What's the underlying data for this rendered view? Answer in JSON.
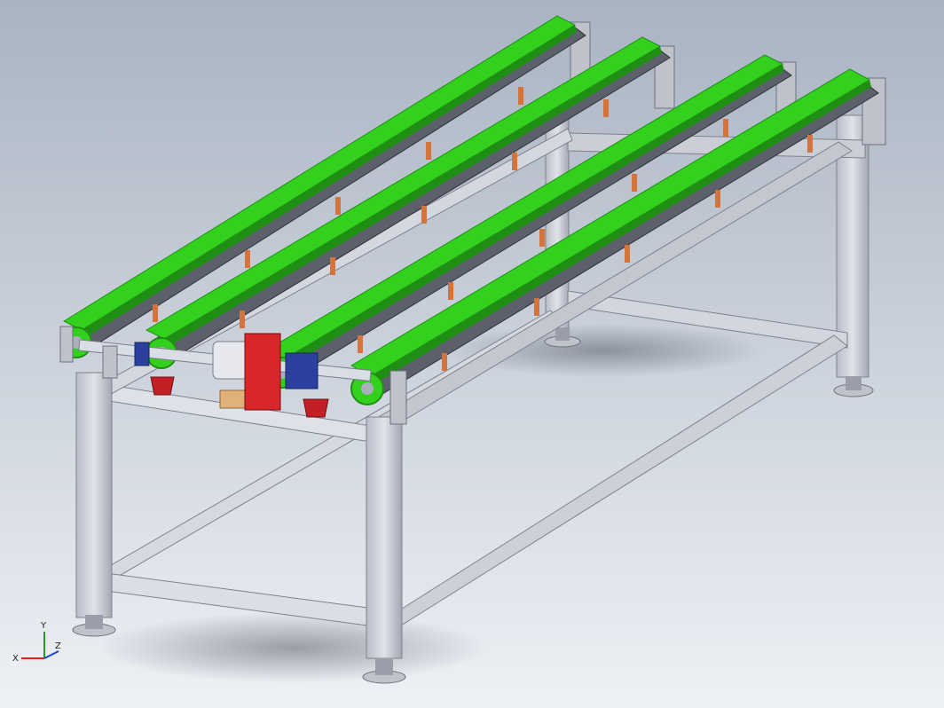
{
  "scene": {
    "background_top": "#a9b3c2",
    "background_bottom": "#eef1f5"
  },
  "colors": {
    "belt": "#33d11e",
    "belt_dark": "#1f8f14",
    "rail": "#6a6f7a",
    "frame": "#c9ccd6",
    "frame_dark": "#9ea2ad",
    "bracket": "#d5733c",
    "motor_mount": "#d8262a",
    "bearing_block": "#c22024",
    "coupling_blue": "#2b3f9e",
    "shaft": "#d9dde6"
  },
  "triad": {
    "x_label": "X",
    "y_label": "Y",
    "z_label": "Z",
    "x_color": "#e02020",
    "y_color": "#20a020",
    "z_color": "#2040e0"
  }
}
